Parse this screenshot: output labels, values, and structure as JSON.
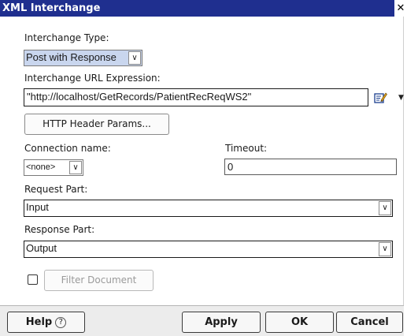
{
  "window": {
    "title": "XML Interchange",
    "close_glyph": "✕"
  },
  "interchange_type": {
    "label": "Interchange Type:",
    "value": "Post with Response"
  },
  "url_expression": {
    "label": "Interchange URL Expression:",
    "value": "\"http://localhost/GetRecords/PatientRecReqWS2\"",
    "edit_icon": "edit-expression-icon"
  },
  "http_header_button": "HTTP Header Params...",
  "connection": {
    "label": "Connection name:",
    "value": "<none>"
  },
  "timeout": {
    "label": "Timeout:",
    "value": "0"
  },
  "request_part": {
    "label": "Request Part:",
    "value": "Input"
  },
  "response_part": {
    "label": "Response Part:",
    "value": "Output"
  },
  "filter_document": {
    "label": "Filter Document",
    "checked": false,
    "enabled": false
  },
  "footer": {
    "help_label": "Help",
    "help_glyph": "?",
    "apply_label": "Apply",
    "ok_label": "OK",
    "cancel_label": "Cancel"
  },
  "colors": {
    "titlebar": "#1f2f8f",
    "highlight": "#c9d6ee"
  }
}
